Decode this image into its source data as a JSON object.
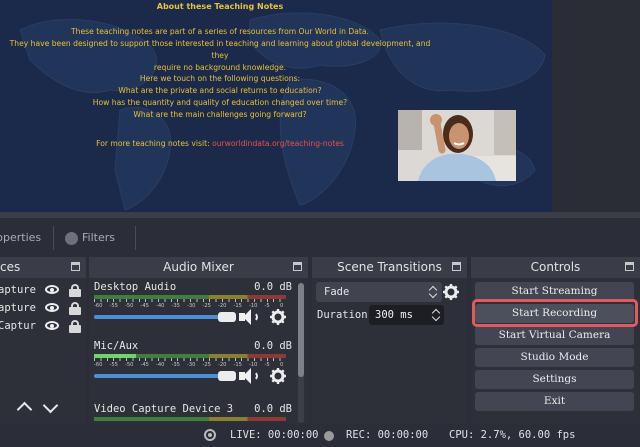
{
  "preview": {
    "slide_title": "About these Teaching Notes",
    "paragraph1": [
      "These teaching notes are part of a series of resources from Our World in Data.",
      "They have been designed to support those interested in teaching and learning about global development, and they",
      "require no background knowledge."
    ],
    "paragraph2": [
      "Here we touch on the following questions:",
      "What are the private and social returns to education?",
      "How has the quantity and quality of education changed over time?",
      "What are the main challenges going forward?"
    ],
    "footer_prefix": "For more teaching notes visit: ",
    "footer_link": "ourworldindata.org/teaching-notes",
    "colors": {
      "slide_bg": "#1b2a4a",
      "gold": "#e8c03a",
      "link": "#e8514a"
    }
  },
  "tabs": {
    "properties": "roperties",
    "filters": "Filters"
  },
  "sources": {
    "title": "ces",
    "items": [
      {
        "name": "apture ]"
      },
      {
        "name": "apture"
      },
      {
        "name": "Captur"
      }
    ]
  },
  "mixer": {
    "title": "Audio Mixer",
    "tick_labels": [
      "-60",
      "-55",
      "-50",
      "-45",
      "-40",
      "-35",
      "-30",
      "-25",
      "-20",
      "-15",
      "-10",
      "-5",
      "0"
    ],
    "channels": [
      {
        "name": "Desktop Audio",
        "db": "0.0 dB",
        "level": 0.0,
        "volume": 0.95
      },
      {
        "name": "Mic/Aux",
        "db": "0.0 dB",
        "level": 0.22,
        "volume": 0.95
      },
      {
        "name": "Video Capture Device 3",
        "db": "0.0 dB",
        "level": 0.0,
        "volume": 0.95
      }
    ]
  },
  "transitions": {
    "title": "Scene Transitions",
    "selected": "Fade",
    "duration_label": "Duration",
    "duration_value": "300 ms"
  },
  "controls": {
    "title": "Controls",
    "buttons": [
      "Start Streaming",
      "Start Recording",
      "Start Virtual Camera",
      "Studio Mode",
      "Settings",
      "Exit"
    ],
    "highlight_color": "#e05a5e"
  },
  "status": {
    "live": "LIVE: 00:00:00",
    "rec": "REC: 00:00:00",
    "cpu": "CPU: 2.7%, 60.00 fps"
  }
}
